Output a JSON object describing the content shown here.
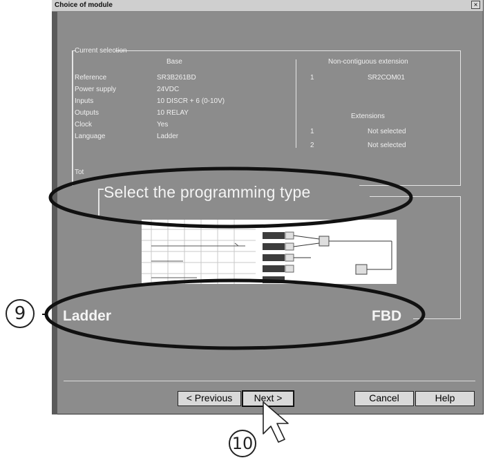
{
  "dialog": {
    "title": "Choice of module",
    "close_glyph": "×"
  },
  "current_selection": {
    "legend": "Current selection",
    "base_header": "Base",
    "rows": [
      {
        "label": "Reference",
        "value": "SR3B261BD"
      },
      {
        "label": "Power supply",
        "value": "24VDC"
      },
      {
        "label": "Inputs",
        "value": "10 DISCR + 6 (0-10V)"
      },
      {
        "label": "Outputs",
        "value": "10 RELAY"
      },
      {
        "label": "Clock",
        "value": "Yes"
      },
      {
        "label": "Language",
        "value": "Ladder"
      }
    ],
    "noncontig_header": "Non-contiguous extension",
    "noncontig": {
      "index": "1",
      "value": "SR2COM01"
    },
    "extensions_header": "Extensions",
    "extensions": [
      {
        "index": "1",
        "value": "Not selected"
      },
      {
        "index": "2",
        "value": "Not selected"
      }
    ],
    "total_partial": "Tot"
  },
  "programming": {
    "title": "Select the programming type",
    "ladder_label": "Ladder",
    "fbd_label": "FBD"
  },
  "buttons": {
    "previous": "< Previous",
    "next": "Next >",
    "cancel": "Cancel",
    "help": "Help"
  },
  "callouts": {
    "nine": "9",
    "ten": "10"
  },
  "colors": {
    "dialog_bg": "#8c8c8c",
    "titlebar_bg": "#cfcfcf",
    "ellipse": "#111111"
  }
}
